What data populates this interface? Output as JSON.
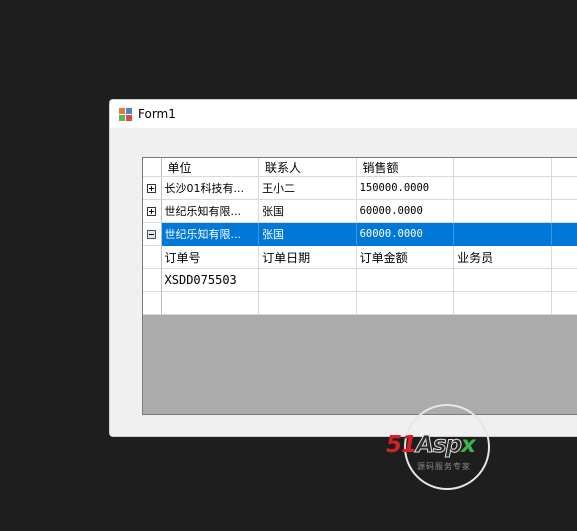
{
  "window": {
    "title": "Form1"
  },
  "grid": {
    "columns": [
      "单位",
      "联系人",
      "销售额",
      ""
    ],
    "rows": [
      {
        "expander": "plus",
        "values": [
          "长沙01科技有...",
          "王小二",
          "150000.0000",
          ""
        ]
      },
      {
        "expander": "plus",
        "values": [
          "世纪乐知有限...",
          "张国",
          "60000.0000",
          ""
        ]
      },
      {
        "expander": "minus",
        "selected": true,
        "values": [
          "世纪乐知有限...",
          "张国",
          "60000.0000",
          ""
        ]
      }
    ],
    "child": {
      "columns": [
        "订单号",
        "订单日期",
        "订单金额",
        "业务员"
      ],
      "rows": [
        [
          "XSDD075503",
          "",
          "",
          ""
        ],
        [
          "",
          "",
          "",
          ""
        ]
      ]
    }
  },
  "watermark": {
    "brand_51": "51",
    "brand_aspx": "Asp",
    "brand_x": "x",
    "subtitle": "源码服务专家"
  },
  "colors": {
    "selection": "#0078d7",
    "grid_background": "#ababab",
    "desktop": "#1e1e1e"
  }
}
